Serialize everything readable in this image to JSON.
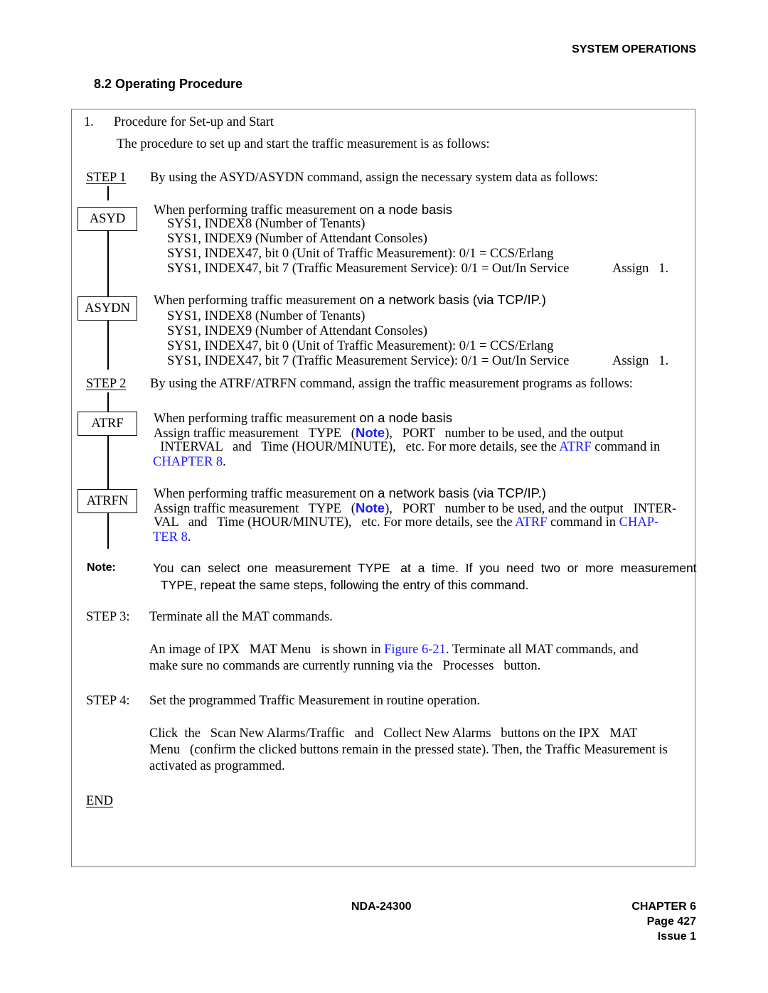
{
  "header": {
    "running_title": "SYSTEM OPERATIONS"
  },
  "section": {
    "number_title": "8.2  Operating Procedure"
  },
  "procedure": {
    "item_number": "1.",
    "item_title": "Procedure for Set-up and Start",
    "intro": "The procedure to set up and start the traffic measurement is as follows:"
  },
  "step1": {
    "label": "STEP 1",
    "text": "By using the ASYD/ASYDN command, assign the necessary system data as follows:",
    "asyd": {
      "command": "ASYD",
      "heading_serif": "When performing traffic measurement ",
      "heading_sans": "on a node basis",
      "lines": [
        "SYS1, INDEX8 (Number of Tenants)",
        "SYS1, INDEX9 (Number of Attendant Consoles)",
        "SYS1, INDEX47, bit 0 (Unit of Traffic Measurement):  0/1 = CCS/Erlang",
        "SYS1, INDEX47, bit 7 (Traffic Measurement Service):  0/1 = Out/In Service"
      ],
      "assign": "Assign   1."
    },
    "asydn": {
      "command": "ASYDN",
      "heading_serif": "When performing traffic measurement ",
      "heading_sans": "on a network basis (via TCP/IP.)",
      "lines": [
        "SYS1, INDEX8 (Number of Tenants)",
        "SYS1, INDEX9 (Number of Attendant Consoles)",
        "SYS1, INDEX47, bit 0 (Unit of Traffic Measurement):  0/1 = CCS/Erlang",
        "SYS1, INDEX47, bit 7 (Traffic Measurement Service):  0/1 = Out/In Service"
      ],
      "assign": "Assign   1."
    }
  },
  "step2": {
    "label": "STEP 2",
    "text": "By using the ATRF/ATRFN command, assign the traffic measurement programs as follows:",
    "atrf": {
      "command": "ATRF",
      "heading_serif": "When performing traffic measurement ",
      "heading_sans": "on a node basis",
      "line1_a": "Assign traffic measurement   TYPE   (",
      "note_link": "Note",
      "line1_b": "),   PORT   number to be used, and the output",
      "line2_a": "  INTERVAL   and   Time (HOUR/MINUTE),   etc. For more details, see the ",
      "atrf_link": "ATRF",
      "line2_b": " command in",
      "chapter_link": "CHAPTER 8",
      "line3_b": "."
    },
    "atrfn": {
      "command": "ATRFN",
      "heading_serif": "When performing traffic measurement ",
      "heading_sans": "on a network basis (via TCP/IP.)",
      "line1_a": "Assign traffic measurement   TYPE   (",
      "note_link": "Note",
      "line1_b": "),   PORT   number to be used, and the output   INTER-",
      "line2_a": "VAL   and   Time (HOUR/MINUTE),   etc. For more details, see the ",
      "atrf_link": "ATRF",
      "line2_b": " command in ",
      "chapter_link_a": "CHAP-",
      "chapter_link_b": "TER 8",
      "line3_b": "."
    }
  },
  "note": {
    "label": "Note:",
    "line1": "You  can  select  one  measurement  TYPE   at  a  time.  If  you  need  two  or  more  measurement",
    "line2": "TYPE,  repeat the same steps, following the entry of this command."
  },
  "step3": {
    "label": "STEP 3:",
    "text": "Terminate all the MAT commands.",
    "para_a": "An image of IPX   MAT Menu   is shown in ",
    "figure_link": "Figure 6-21",
    "para_b": ". Terminate all MAT commands, and",
    "para_line2": "make sure no commands are currently running via the   Processes   button."
  },
  "step4": {
    "label": "STEP 4:",
    "text": "Set the programmed Traffic Measurement in routine operation.",
    "para_lines": [
      "Click  the   Scan New Alarms/Traffic   and   Collect New Alarms   buttons on the IPX   MAT",
      "Menu   (confirm the clicked buttons remain in the pressed state). Then, the Traffic Measurement is",
      "activated as programmed."
    ]
  },
  "end_label": "END",
  "footer": {
    "doc_number": "NDA-24300",
    "chapter": "CHAPTER 6",
    "page": "Page 427",
    "issue": "Issue 1"
  },
  "colors": {
    "link": "#1a1aff",
    "frame": "#777777",
    "text": "#000000"
  }
}
